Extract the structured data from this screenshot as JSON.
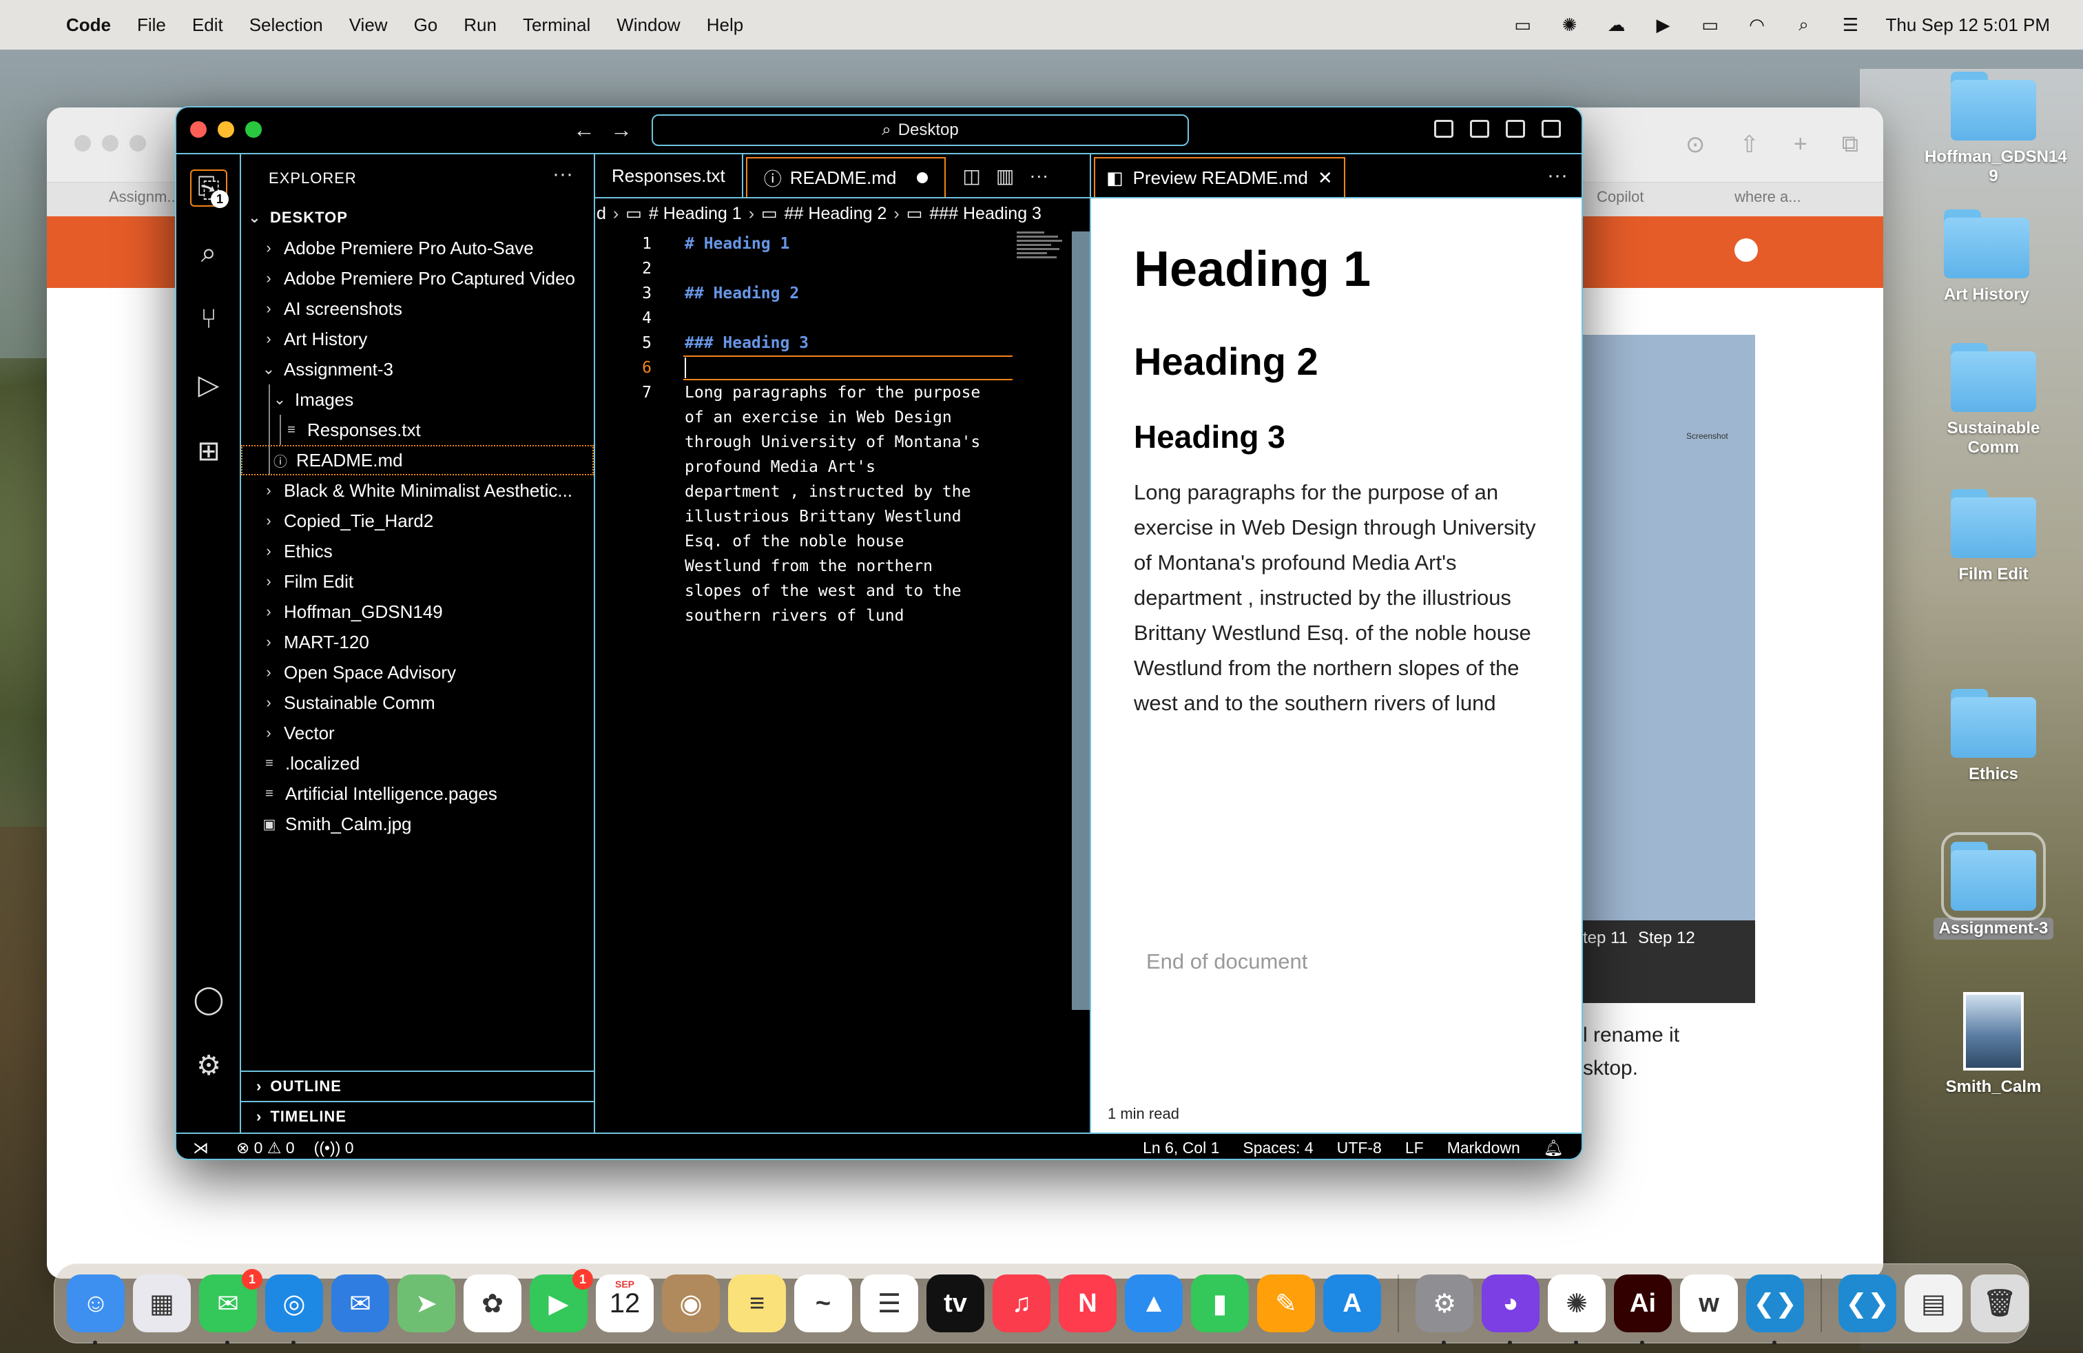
{
  "menubar": {
    "app": "Code",
    "items": [
      "File",
      "Edit",
      "Selection",
      "View",
      "Go",
      "Run",
      "Terminal",
      "Window",
      "Help"
    ],
    "clock": "Thu Sep 12  5:01 PM",
    "icons": [
      "stage-manager-icon",
      "chatgpt-icon",
      "creative-cloud-icon",
      "play-icon",
      "battery-icon",
      "wifi-icon",
      "spotlight-icon",
      "control-center-icon"
    ]
  },
  "browser": {
    "tabs": [
      "Assignm...",
      "Copilot",
      "where a..."
    ],
    "text_lines": [
      "l rename it",
      "sktop."
    ],
    "steps": [
      "tep 11",
      "Step 12"
    ],
    "thumb_label": "Screenshot"
  },
  "desktop_icons": [
    "Hoffman_GDSN14\n9",
    "Art History",
    "Sustainable Comm",
    "Film Edit",
    "Ethics",
    "Assignment-3",
    "Smith_Calm"
  ],
  "vscode": {
    "command_center": "Desktop",
    "explorer_title": "EXPLORER",
    "root": "DESKTOP",
    "tree": [
      {
        "label": "Adobe Premiere Pro Auto-Save",
        "type": "folder",
        "depth": 0,
        "open": false
      },
      {
        "label": "Adobe Premiere Pro Captured Video",
        "type": "folder",
        "depth": 0,
        "open": false
      },
      {
        "label": "AI screenshots",
        "type": "folder",
        "depth": 0,
        "open": false
      },
      {
        "label": "Art History",
        "type": "folder",
        "depth": 0,
        "open": false
      },
      {
        "label": "Assignment-3",
        "type": "folder",
        "depth": 0,
        "open": true
      },
      {
        "label": "Images",
        "type": "folder",
        "depth": 1,
        "open": true
      },
      {
        "label": "Responses.txt",
        "type": "text",
        "depth": 2
      },
      {
        "label": "README.md",
        "type": "info",
        "depth": 1,
        "focus": true
      },
      {
        "label": "Black & White Minimalist Aesthetic...",
        "type": "folder",
        "depth": 0,
        "open": false
      },
      {
        "label": "Copied_Tie_Hard2",
        "type": "folder",
        "depth": 0,
        "open": false
      },
      {
        "label": "Ethics",
        "type": "folder",
        "depth": 0,
        "open": false
      },
      {
        "label": "Film Edit",
        "type": "folder",
        "depth": 0,
        "open": false
      },
      {
        "label": "Hoffman_GDSN149",
        "type": "folder",
        "depth": 0,
        "open": false
      },
      {
        "label": "MART-120",
        "type": "folder",
        "depth": 0,
        "open": false
      },
      {
        "label": "Open Space Advisory",
        "type": "folder",
        "depth": 0,
        "open": false
      },
      {
        "label": "Sustainable Comm",
        "type": "folder",
        "depth": 0,
        "open": false
      },
      {
        "label": "Vector",
        "type": "folder",
        "depth": 0,
        "open": false
      },
      {
        "label": ".localized",
        "type": "text",
        "depth": 0
      },
      {
        "label": "Artificial Intelligence.pages",
        "type": "text",
        "depth": 0
      },
      {
        "label": "Smith_Calm.jpg",
        "type": "image",
        "depth": 0
      }
    ],
    "outline": "OUTLINE",
    "timeline": "TIMELINE",
    "explorer_badge": "1",
    "tabs": {
      "responses": "Responses.txt",
      "readme": "README.md",
      "preview": "Preview README.md"
    },
    "breadcrumb": [
      "d",
      "# Heading 1",
      "## Heading 2",
      "### Heading 3"
    ],
    "code_lines": [
      {
        "n": "1",
        "text": "# Heading 1",
        "kind": "heading"
      },
      {
        "n": "2",
        "text": "",
        "kind": "plain"
      },
      {
        "n": "3",
        "text": "## Heading 2",
        "kind": "heading"
      },
      {
        "n": "4",
        "text": "",
        "kind": "plain"
      },
      {
        "n": "5",
        "text": "### Heading 3",
        "kind": "heading"
      },
      {
        "n": "6",
        "text": "",
        "kind": "current"
      },
      {
        "n": "7",
        "text": "Long paragraphs for the purpose\nof an exercise in Web Design\nthrough University of Montana's\nprofound Media Art's\ndepartment , instructed by the\nillustrious Brittany Westlund\nEsq. of the noble house\nWestlund from the northern\nslopes of the west and to the\nsouthern rivers of lund",
        "kind": "para"
      }
    ],
    "preview": {
      "h1": "Heading 1",
      "h2": "Heading 2",
      "h3": "Heading 3",
      "paragraph": "Long paragraphs for the purpose of an exercise in Web Design through University of Montana's profound Media Art's department , instructed by the illustrious Brittany Westlund Esq. of the noble house Westlund from the northern slopes of the west and to the southern rivers of lund",
      "end": "End of document",
      "read_time": "1 min read"
    },
    "status": {
      "errors": "0",
      "warnings": "0",
      "ports": "0",
      "position": "Ln 6, Col 1",
      "spaces": "Spaces: 4",
      "encoding": "UTF-8",
      "eol": "LF",
      "language": "Markdown"
    }
  },
  "dock": {
    "apps": [
      {
        "name": "finder-icon",
        "color": "#3d8ff0",
        "glyph": "☺",
        "running": true
      },
      {
        "name": "launchpad-icon",
        "color": "#e8e8ee",
        "glyph": "▦"
      },
      {
        "name": "messages-icon",
        "color": "#34c759",
        "glyph": "✉",
        "badge": "1",
        "running": true
      },
      {
        "name": "safari-icon",
        "color": "#1e88e5",
        "glyph": "◎",
        "running": true
      },
      {
        "name": "mail-icon",
        "color": "#2f7de1",
        "glyph": "✉"
      },
      {
        "name": "maps-icon",
        "color": "#6fbf73",
        "glyph": "➤"
      },
      {
        "name": "photos-icon",
        "color": "#ffffff",
        "glyph": "✿"
      },
      {
        "name": "facetime-icon",
        "color": "#34c759",
        "glyph": "▶",
        "badge": "1"
      },
      {
        "name": "calendar-icon",
        "color": "#ffffff",
        "glyph": "12"
      },
      {
        "name": "contacts-icon",
        "color": "#b08a5c",
        "glyph": "◉"
      },
      {
        "name": "notes-icon",
        "color": "#fbe17a",
        "glyph": "≡"
      },
      {
        "name": "freeform-icon",
        "color": "#ffffff",
        "glyph": "~"
      },
      {
        "name": "reminders-icon",
        "color": "#ffffff",
        "glyph": "☰"
      },
      {
        "name": "apple-tv-icon",
        "color": "#111111",
        "glyph": "tv"
      },
      {
        "name": "music-icon",
        "color": "#fa3c4c",
        "glyph": "♫"
      },
      {
        "name": "news-icon",
        "color": "#ff3b4e",
        "glyph": "N"
      },
      {
        "name": "keynote-icon",
        "color": "#2b8cf0",
        "glyph": "▲"
      },
      {
        "name": "numbers-icon",
        "color": "#34c759",
        "glyph": "▮"
      },
      {
        "name": "pages-icon",
        "color": "#ff9f0a",
        "glyph": "✎"
      },
      {
        "name": "app-store-icon",
        "color": "#1e88e5",
        "glyph": "A"
      },
      {
        "name": "system-settings-icon",
        "color": "#8e8e93",
        "glyph": "⚙",
        "running": true
      },
      {
        "name": "github-desktop-icon",
        "color": "#7b3fe4",
        "glyph": "◕",
        "running": true
      },
      {
        "name": "chatgpt-icon",
        "color": "#ffffff",
        "glyph": "✺",
        "running": true
      },
      {
        "name": "illustrator-icon",
        "color": "#330000",
        "glyph": "Ai",
        "running": true
      },
      {
        "name": "word-icon",
        "color": "#ffffff",
        "glyph": "w"
      },
      {
        "name": "vscode-icon",
        "color": "#1f8ad2",
        "glyph": "❮❯",
        "running": true
      },
      {
        "name": "vscode-recent-icon",
        "color": "#1f8ad2",
        "glyph": "❮❯"
      },
      {
        "name": "document-icon",
        "color": "#f2f2f2",
        "glyph": "▤"
      },
      {
        "name": "trash-icon",
        "color": "#dcdcdc",
        "glyph": "🗑"
      }
    ],
    "calendar_month": "SEP"
  }
}
